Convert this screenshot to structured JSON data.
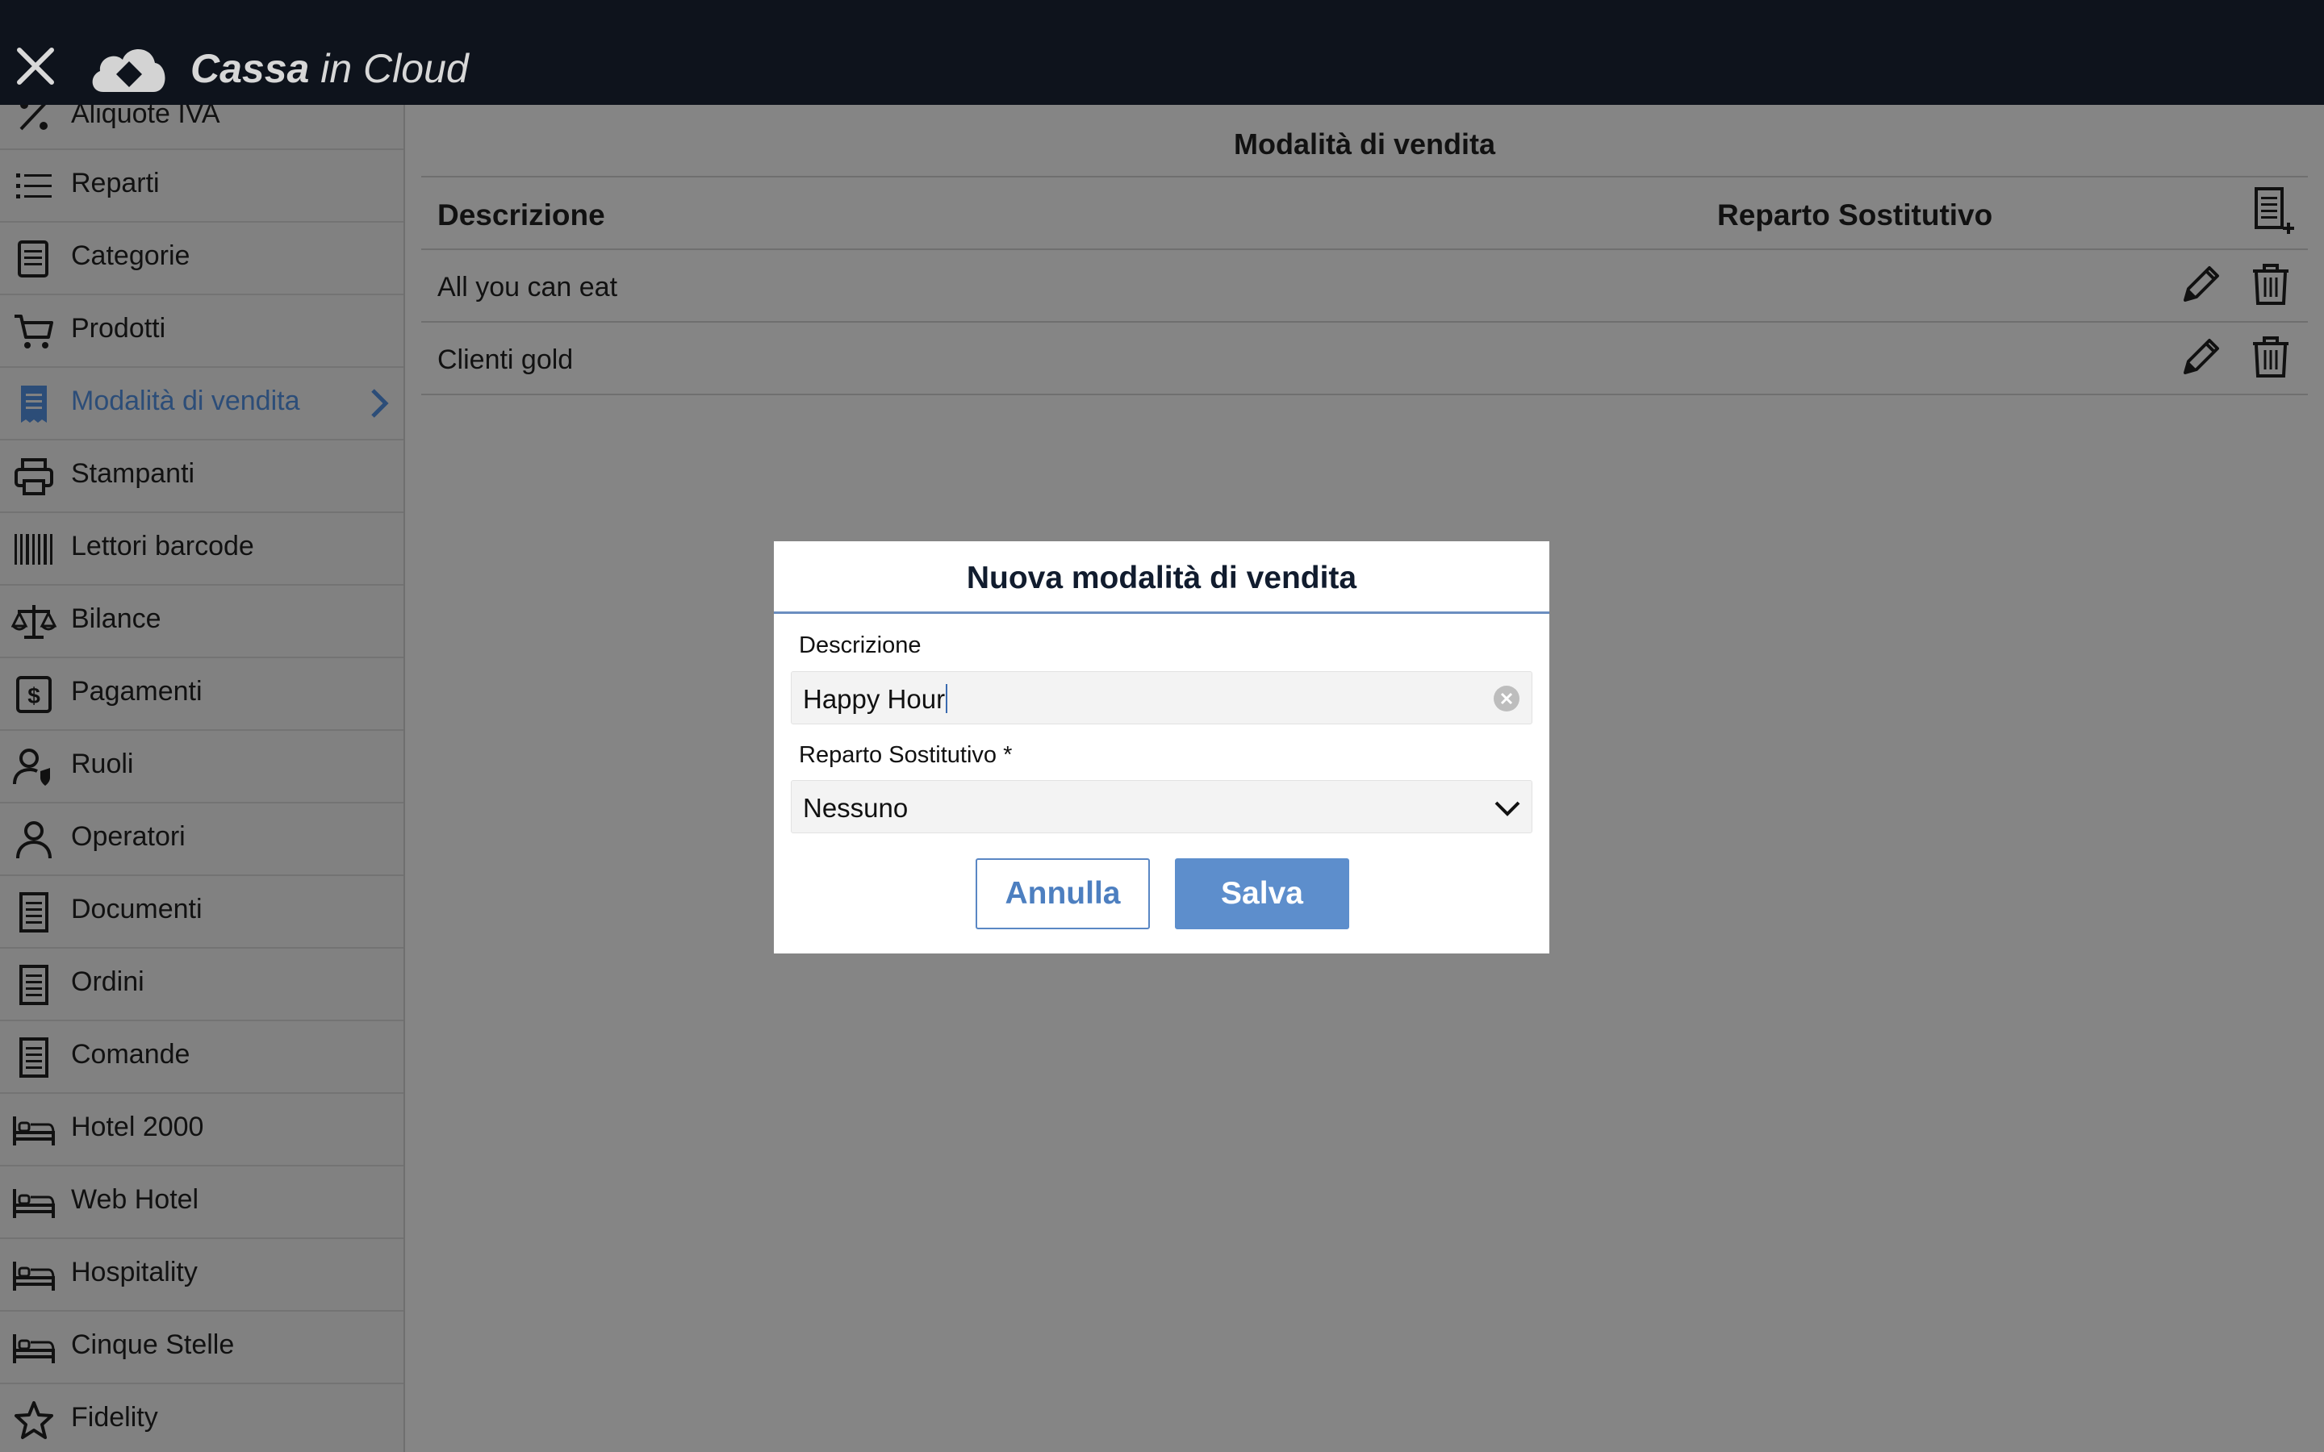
{
  "app": {
    "brand_bold": "Cassa",
    "brand_rest": " in Cloud"
  },
  "sidebar": {
    "items": [
      {
        "label": "Aliquote IVA",
        "icon": "percent-icon"
      },
      {
        "label": "Reparti",
        "icon": "list-icon"
      },
      {
        "label": "Categorie",
        "icon": "category-icon"
      },
      {
        "label": "Prodotti",
        "icon": "cart-icon"
      },
      {
        "label": "Modalità di vendita",
        "icon": "receipt-icon",
        "active": true
      },
      {
        "label": "Stampanti",
        "icon": "printer-icon"
      },
      {
        "label": "Lettori barcode",
        "icon": "barcode-icon"
      },
      {
        "label": "Bilance",
        "icon": "scale-icon"
      },
      {
        "label": "Pagamenti",
        "icon": "dollar-icon"
      },
      {
        "label": "Ruoli",
        "icon": "user-shield-icon"
      },
      {
        "label": "Operatori",
        "icon": "user-icon"
      },
      {
        "label": "Documenti",
        "icon": "document-icon"
      },
      {
        "label": "Ordini",
        "icon": "document-icon"
      },
      {
        "label": "Comande",
        "icon": "document-icon"
      },
      {
        "label": "Hotel 2000",
        "icon": "bed-icon"
      },
      {
        "label": "Web Hotel",
        "icon": "bed-icon"
      },
      {
        "label": "Hospitality",
        "icon": "bed-icon"
      },
      {
        "label": "Cinque Stelle",
        "icon": "bed-icon"
      },
      {
        "label": "Fidelity",
        "icon": "star-icon"
      }
    ]
  },
  "main": {
    "title": "Modalità di vendita",
    "columns": [
      "Descrizione",
      "Reparto Sostitutivo"
    ],
    "rows": [
      {
        "descrizione": "All you can eat",
        "reparto": ""
      },
      {
        "descrizione": "Clienti gold",
        "reparto": ""
      }
    ]
  },
  "modal": {
    "title": "Nuova modalità di vendita",
    "descrizione_label": "Descrizione",
    "descrizione_value": "Happy Hour",
    "reparto_label": "Reparto Sostitutivo *",
    "reparto_value": "Nessuno",
    "cancel_label": "Annulla",
    "save_label": "Salva"
  },
  "colors": {
    "topbar": "#0e131c",
    "overlay": "#858585",
    "accent": "#5d8ecc",
    "active_text": "#2c4d78"
  }
}
